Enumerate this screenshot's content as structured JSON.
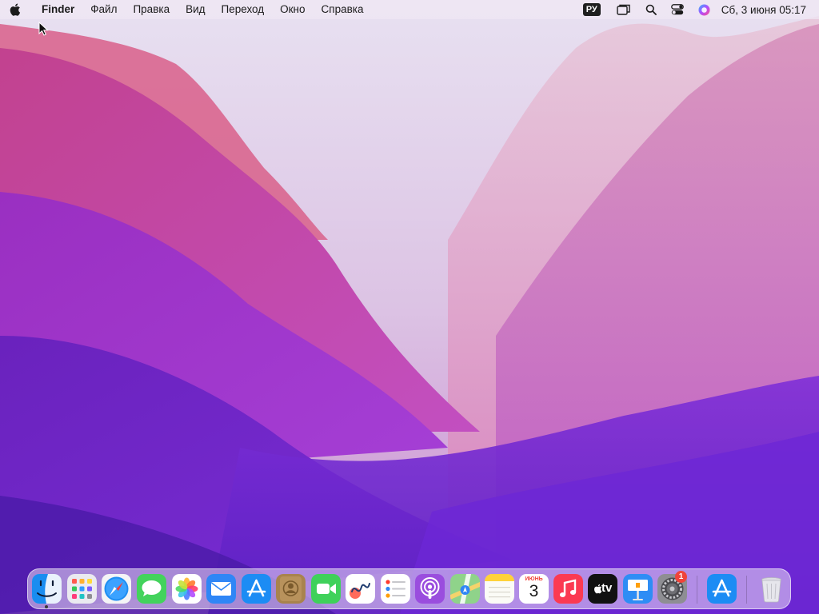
{
  "menubar": {
    "apple_icon": "apple-logo-icon",
    "app_name": "Finder",
    "menus": [
      "Файл",
      "Правка",
      "Вид",
      "Переход",
      "Окно",
      "Справка"
    ],
    "status": {
      "input_language": "РУ",
      "icons": [
        "window-stack-icon",
        "spotlight-search-icon",
        "control-center-icon",
        "siri-icon"
      ],
      "datetime": "Сб, 3 июня  05:17"
    }
  },
  "dock": {
    "apps": [
      {
        "name": "Finder",
        "icon": "finder-icon",
        "running": true
      },
      {
        "name": "Launchpad",
        "icon": "launchpad-icon"
      },
      {
        "name": "Safari",
        "icon": "safari-icon"
      },
      {
        "name": "Messages",
        "icon": "messages-icon"
      },
      {
        "name": "Photos",
        "icon": "photos-icon"
      },
      {
        "name": "Mail",
        "icon": "mail-icon"
      },
      {
        "name": "App Store",
        "icon": "app-store-icon"
      },
      {
        "name": "Contacts",
        "icon": "contacts-icon"
      },
      {
        "name": "FaceTime",
        "icon": "facetime-icon"
      },
      {
        "name": "Freeform",
        "icon": "freeform-icon"
      },
      {
        "name": "Reminders",
        "icon": "reminders-icon"
      },
      {
        "name": "Podcasts",
        "icon": "podcasts-icon"
      },
      {
        "name": "Maps",
        "icon": "maps-icon"
      },
      {
        "name": "Notes",
        "icon": "notes-icon"
      },
      {
        "name": "Calendar",
        "icon": "calendar-icon",
        "month": "ИЮНЬ",
        "day": "3"
      },
      {
        "name": "Music",
        "icon": "music-icon"
      },
      {
        "name": "TV",
        "icon": "apple-tv-icon",
        "label": "tv"
      },
      {
        "name": "Keynote",
        "icon": "keynote-icon"
      },
      {
        "name": "System Settings",
        "icon": "system-settings-icon",
        "badge": "1"
      }
    ],
    "recent": [
      {
        "name": "App Store",
        "icon": "app-store-icon"
      }
    ],
    "trash": {
      "name": "Trash",
      "icon": "trash-icon"
    }
  }
}
